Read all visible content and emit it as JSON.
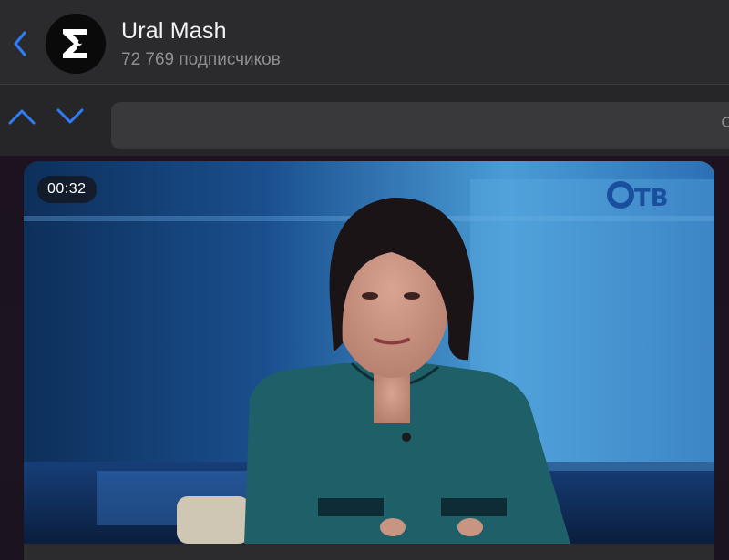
{
  "header": {
    "back_icon": "chevron-left-icon",
    "channel_name": "Ural Mash",
    "subscribers": "72 769 подписчиков",
    "avatar_icon": "sigma-logo-icon"
  },
  "search": {
    "up_icon": "chevron-up-icon",
    "down_icon": "chevron-down-icon",
    "value": "",
    "placeholder": ""
  },
  "message": {
    "video_duration": "00:32",
    "watermark": "ОТВ",
    "caption_partial": ""
  },
  "colors": {
    "accent": "#2f7cf6",
    "header_bg": "#2b2b2d",
    "chat_bg": "#1d1320"
  }
}
